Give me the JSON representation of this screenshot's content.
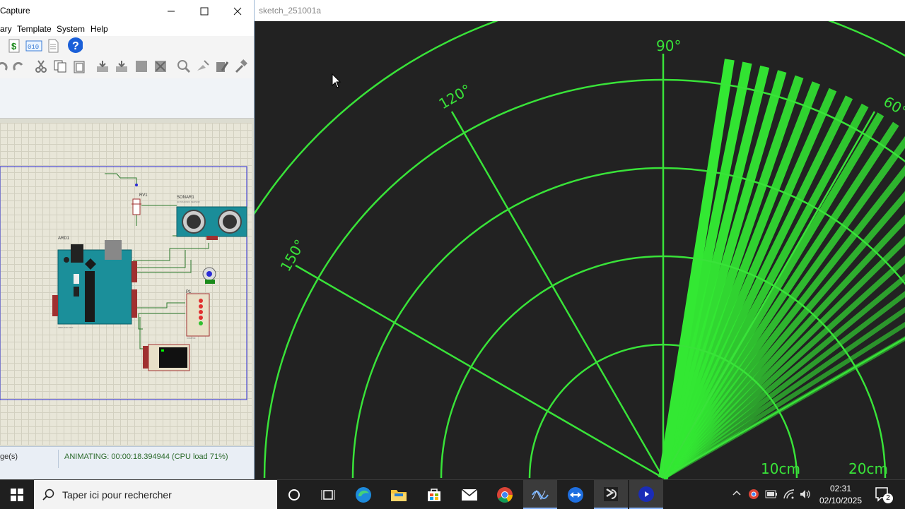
{
  "left_window": {
    "title": "Capture",
    "menu": [
      "ary",
      "Template",
      "System",
      "Help"
    ],
    "status_left": "ge(s)",
    "status_right": "ANIMATING: 00:00:18.394944 (CPU load 71%)",
    "schematic": {
      "components": [
        {
          "ref": "RV1"
        },
        {
          "ref": "SONAR1",
          "subtitle": "ULTRASONIC SENSOR"
        },
        {
          "ref": "ARD1",
          "footer": "ARDUINO UNO"
        },
        {
          "ref": "P1",
          "footer": "COMPIM"
        }
      ]
    }
  },
  "right_window": {
    "title": "sketch_251001a",
    "radar": {
      "angle_labels": [
        "90°",
        "120°",
        "150°",
        "60°"
      ],
      "distance_labels": [
        "10cm",
        "20cm"
      ],
      "sweep": {
        "start_deg": 30,
        "end_deg": 81,
        "count": 22
      },
      "color": "#33e833"
    }
  },
  "taskbar": {
    "search_placeholder": "Taper ici pour rechercher",
    "time": "02:31",
    "date": "02/10/2025",
    "notifications": "2",
    "apps": [
      "task-view",
      "edge",
      "file-explorer",
      "store",
      "mail",
      "chrome",
      "proteus",
      "teamviewer",
      "processing",
      "media-player"
    ]
  }
}
